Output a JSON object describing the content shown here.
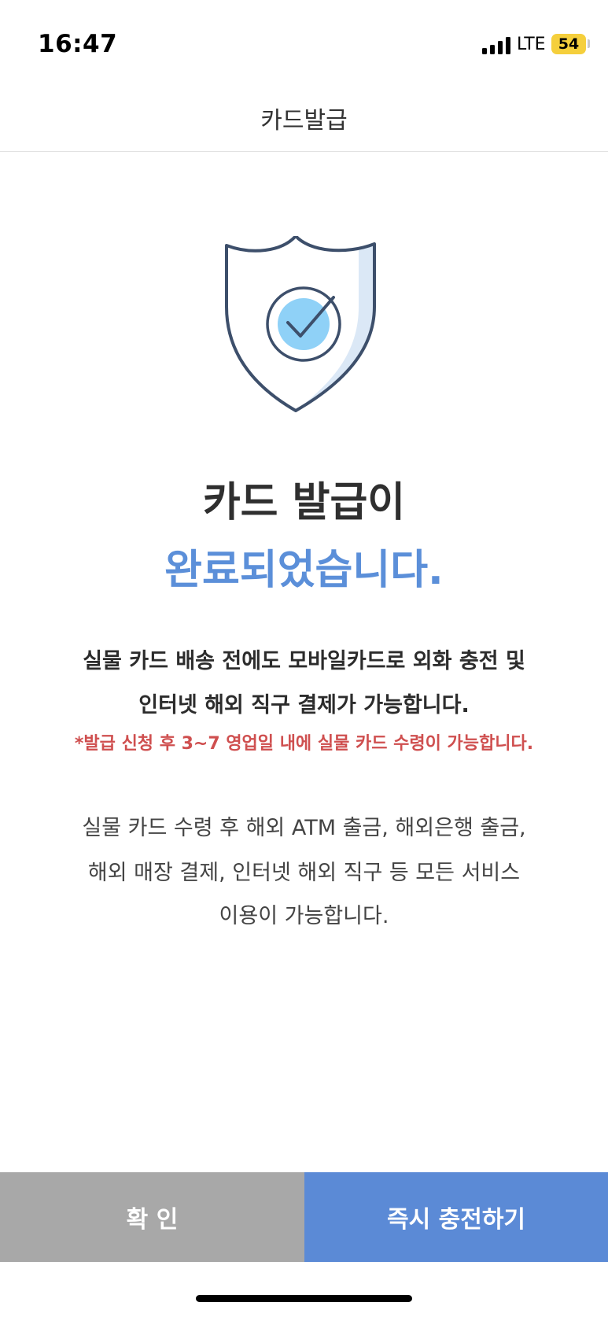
{
  "status_bar": {
    "time": "16:47",
    "network": "LTE",
    "battery": "54",
    "battery_color": "#f5cf3c"
  },
  "header": {
    "title": "카드발급"
  },
  "illustration": {
    "icon": "shield-check-icon",
    "colors": {
      "outline": "#3d4f6b",
      "fill": "#dbe8f6",
      "circle": "#8fd1f7"
    }
  },
  "headline": {
    "line1": "카드 발급이",
    "line2": "완료되었습니다.",
    "accent_color": "#5b8fd9"
  },
  "description": {
    "line1": "실물 카드 배송 전에도 모바일카드로 외화 충전 및",
    "line2": "인터넷 해외 직구 결제가 가능합니다.",
    "notice": "*발급 신청 후 3~7 영업일 내에 실물 카드 수령이 가능합니다."
  },
  "info": {
    "line1": "실물 카드 수령 후 해외 ATM 출금, 해외은행 출금,",
    "line2": "해외 매장 결제, 인터넷 해외 직구 등 모든 서비스",
    "line3": "이용이 가능합니다."
  },
  "buttons": {
    "confirm": "확 인",
    "charge": "즉시 충전하기",
    "confirm_color": "#a8a8a8",
    "charge_color": "#5b8ad6"
  }
}
